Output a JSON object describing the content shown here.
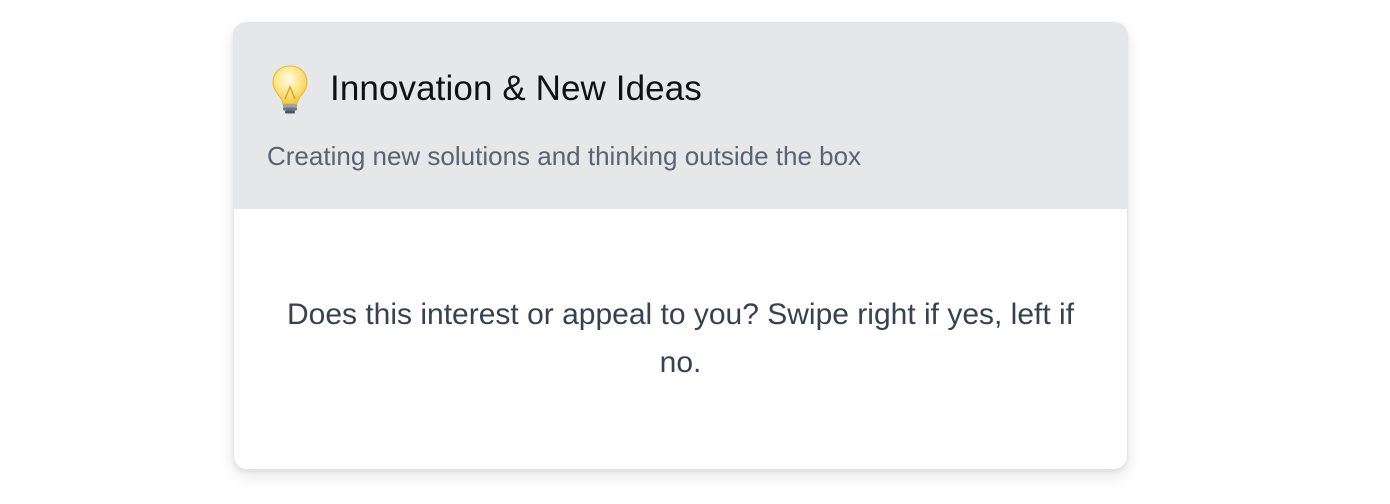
{
  "card": {
    "icon": "lightbulb-icon",
    "title": "Innovation & New Ideas",
    "subtitle": "Creating new solutions and thinking outside the box",
    "prompt": "Does this interest or appeal to you? Swipe right if yes, left if no."
  },
  "colors": {
    "header_bg": "#e6e7e9",
    "card_bg": "#ffffff",
    "title": "#111111",
    "subtitle": "#5b6270",
    "prompt": "#374151"
  }
}
